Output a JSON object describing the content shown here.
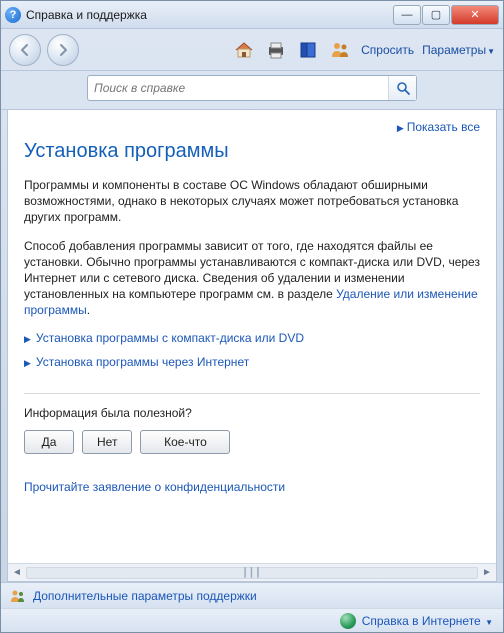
{
  "window": {
    "title": "Справка и поддержка"
  },
  "toolbar": {
    "ask": "Спросить",
    "options": "Параметры"
  },
  "search": {
    "placeholder": "Поиск в справке"
  },
  "content": {
    "show_all": "Показать все",
    "title": "Установка программы",
    "para1": "Программы и компоненты в составе ОС Windows обладают обширными возможностями, однако в некоторых случаях может потребоваться установка других программ.",
    "para2_a": "Способ добавления программы зависит от того, где находятся файлы ее установки. Обычно программы устанавливаются с компакт-диска или DVD, через Интернет или с сетевого диска. Сведения об удалении и изменении установленных на компьютере программ см. в разделе ",
    "para2_link": "Удаление или изменение программы",
    "para2_b": ".",
    "exp1": "Установка программы с компакт-диска или DVD",
    "exp2": "Установка программы через Интернет",
    "feedback_q": "Информация была полезной?",
    "btn_yes": "Да",
    "btn_no": "Нет",
    "btn_some": "Кое-что",
    "privacy": "Прочитайте заявление о конфиденциальности"
  },
  "status": {
    "more_support": "Дополнительные параметры поддержки",
    "online_help": "Справка в Интернете"
  }
}
